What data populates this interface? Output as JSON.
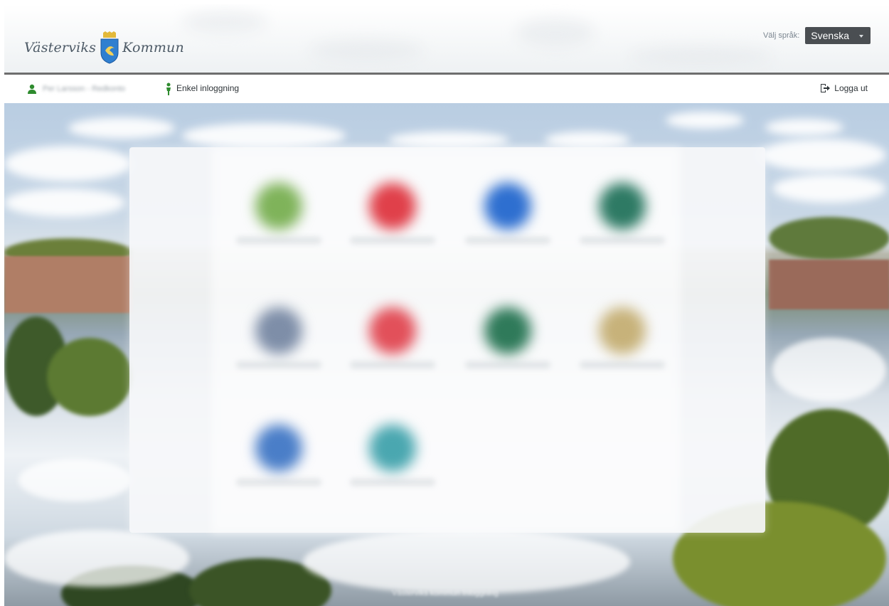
{
  "header": {
    "logo_left": "Västerviks",
    "logo_right": "Kommun",
    "language_label": "Välj språk:",
    "language_value": "Svenska"
  },
  "userbar": {
    "user_name": "Per Larsson - Redkonto",
    "sso_label": "Enkel inloggning",
    "logout_label": "Logga ut"
  },
  "apps": [
    {
      "color": "#7fb35a"
    },
    {
      "color": "#e0404a"
    },
    {
      "color": "#2e6fd0"
    },
    {
      "color": "#2e7a64"
    },
    {
      "color": "#7e8ea8"
    },
    {
      "color": "#e2505a"
    },
    {
      "color": "#2f7a5a"
    },
    {
      "color": "#c7b27a"
    },
    {
      "color": "#4a7ec8"
    },
    {
      "color": "#4aa7b0"
    }
  ],
  "footer": {
    "text": "Västerviks kommun Inloggning"
  }
}
